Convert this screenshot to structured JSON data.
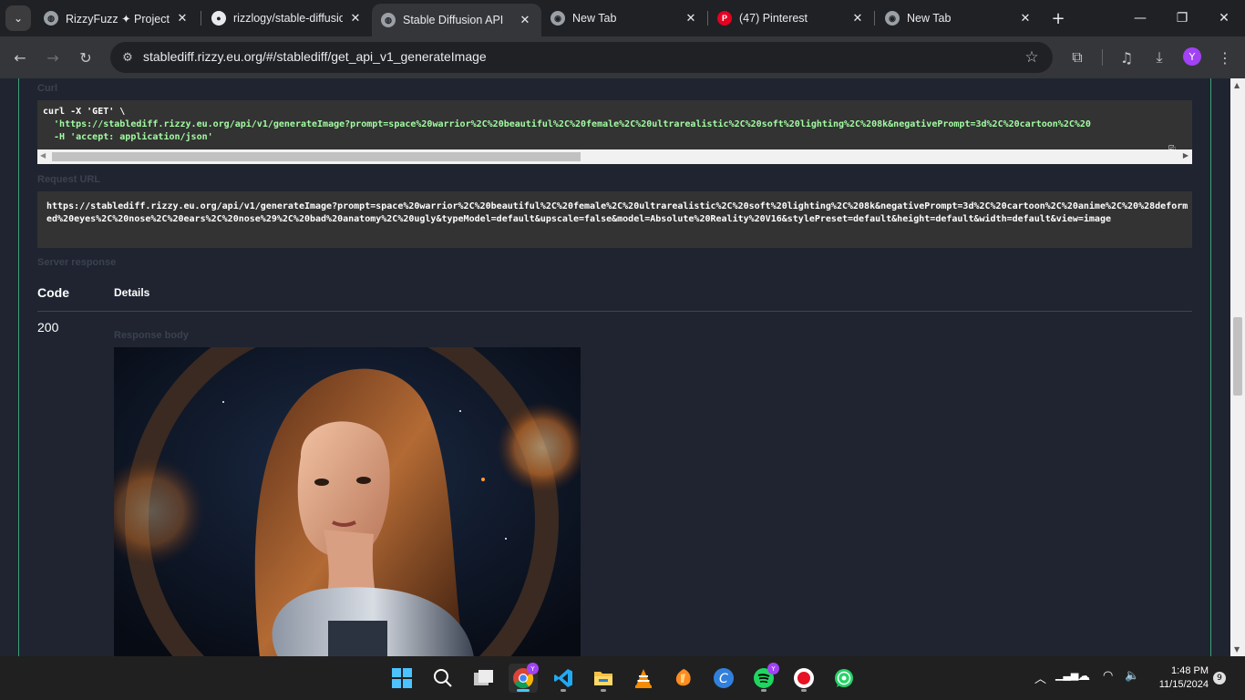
{
  "browser": {
    "tabs": [
      {
        "title": "RizzyFuzz ✦ Projects",
        "icon": "globe-icon"
      },
      {
        "title": "rizzlogy/stable-diffusion-api",
        "icon": "github-icon"
      },
      {
        "title": "Stable Diffusion API",
        "icon": "globe-icon",
        "active": true
      },
      {
        "title": "New Tab",
        "icon": "chrome-icon"
      },
      {
        "title": "(47) Pinterest",
        "icon": "pinterest-icon"
      },
      {
        "title": "New Tab",
        "icon": "chrome-icon"
      }
    ],
    "url": "stablediff.rizzy.eu.org/#/stablediff/get_api_v1_generateImage",
    "profile_initial": "Y"
  },
  "page": {
    "curl_label": "Curl",
    "curl_lines": [
      "curl -X 'GET' \\",
      "  'https://stablediff.rizzy.eu.org/api/v1/generateImage?prompt=space%20warrior%2C%20beautiful%2C%20female%2C%20ultrarealistic%2C%20soft%20lighting%2C%208k&negativePrompt=3d%2C%20cartoon%2C%20",
      "  -H 'accept: application/json'"
    ],
    "request_url_label": "Request URL",
    "request_url": "https://stablediff.rizzy.eu.org/api/v1/generateImage?prompt=space%20warrior%2C%20beautiful%2C%20female%2C%20ultrarealistic%2C%20soft%20lighting%2C%208k&negativePrompt=3d%2C%20cartoon%2C%20anime%2C%20%28deformed%20eyes%2C%20nose%2C%20ears%2C%20nose%29%2C%20bad%20anatomy%2C%20ugly&typeModel=default&upscale=false&model=Absolute%20Reality%20V16&stylePreset=default&height=default&width=default&view=image",
    "server_response_label": "Server response",
    "col_code": "Code",
    "col_details": "Details",
    "response_code": "200",
    "response_body_label": "Response body"
  },
  "taskbar": {
    "apps": [
      "windows-start-icon",
      "search-icon",
      "task-view-icon",
      "chrome-icon",
      "vscode-icon",
      "file-explorer-icon",
      "vlc-icon",
      "fl-studio-icon",
      "canva-icon",
      "spotify-icon",
      "screen-recorder-icon",
      "whatsapp-icon"
    ],
    "time": "1:48 PM",
    "date": "11/15/2024",
    "notifications": "9"
  }
}
